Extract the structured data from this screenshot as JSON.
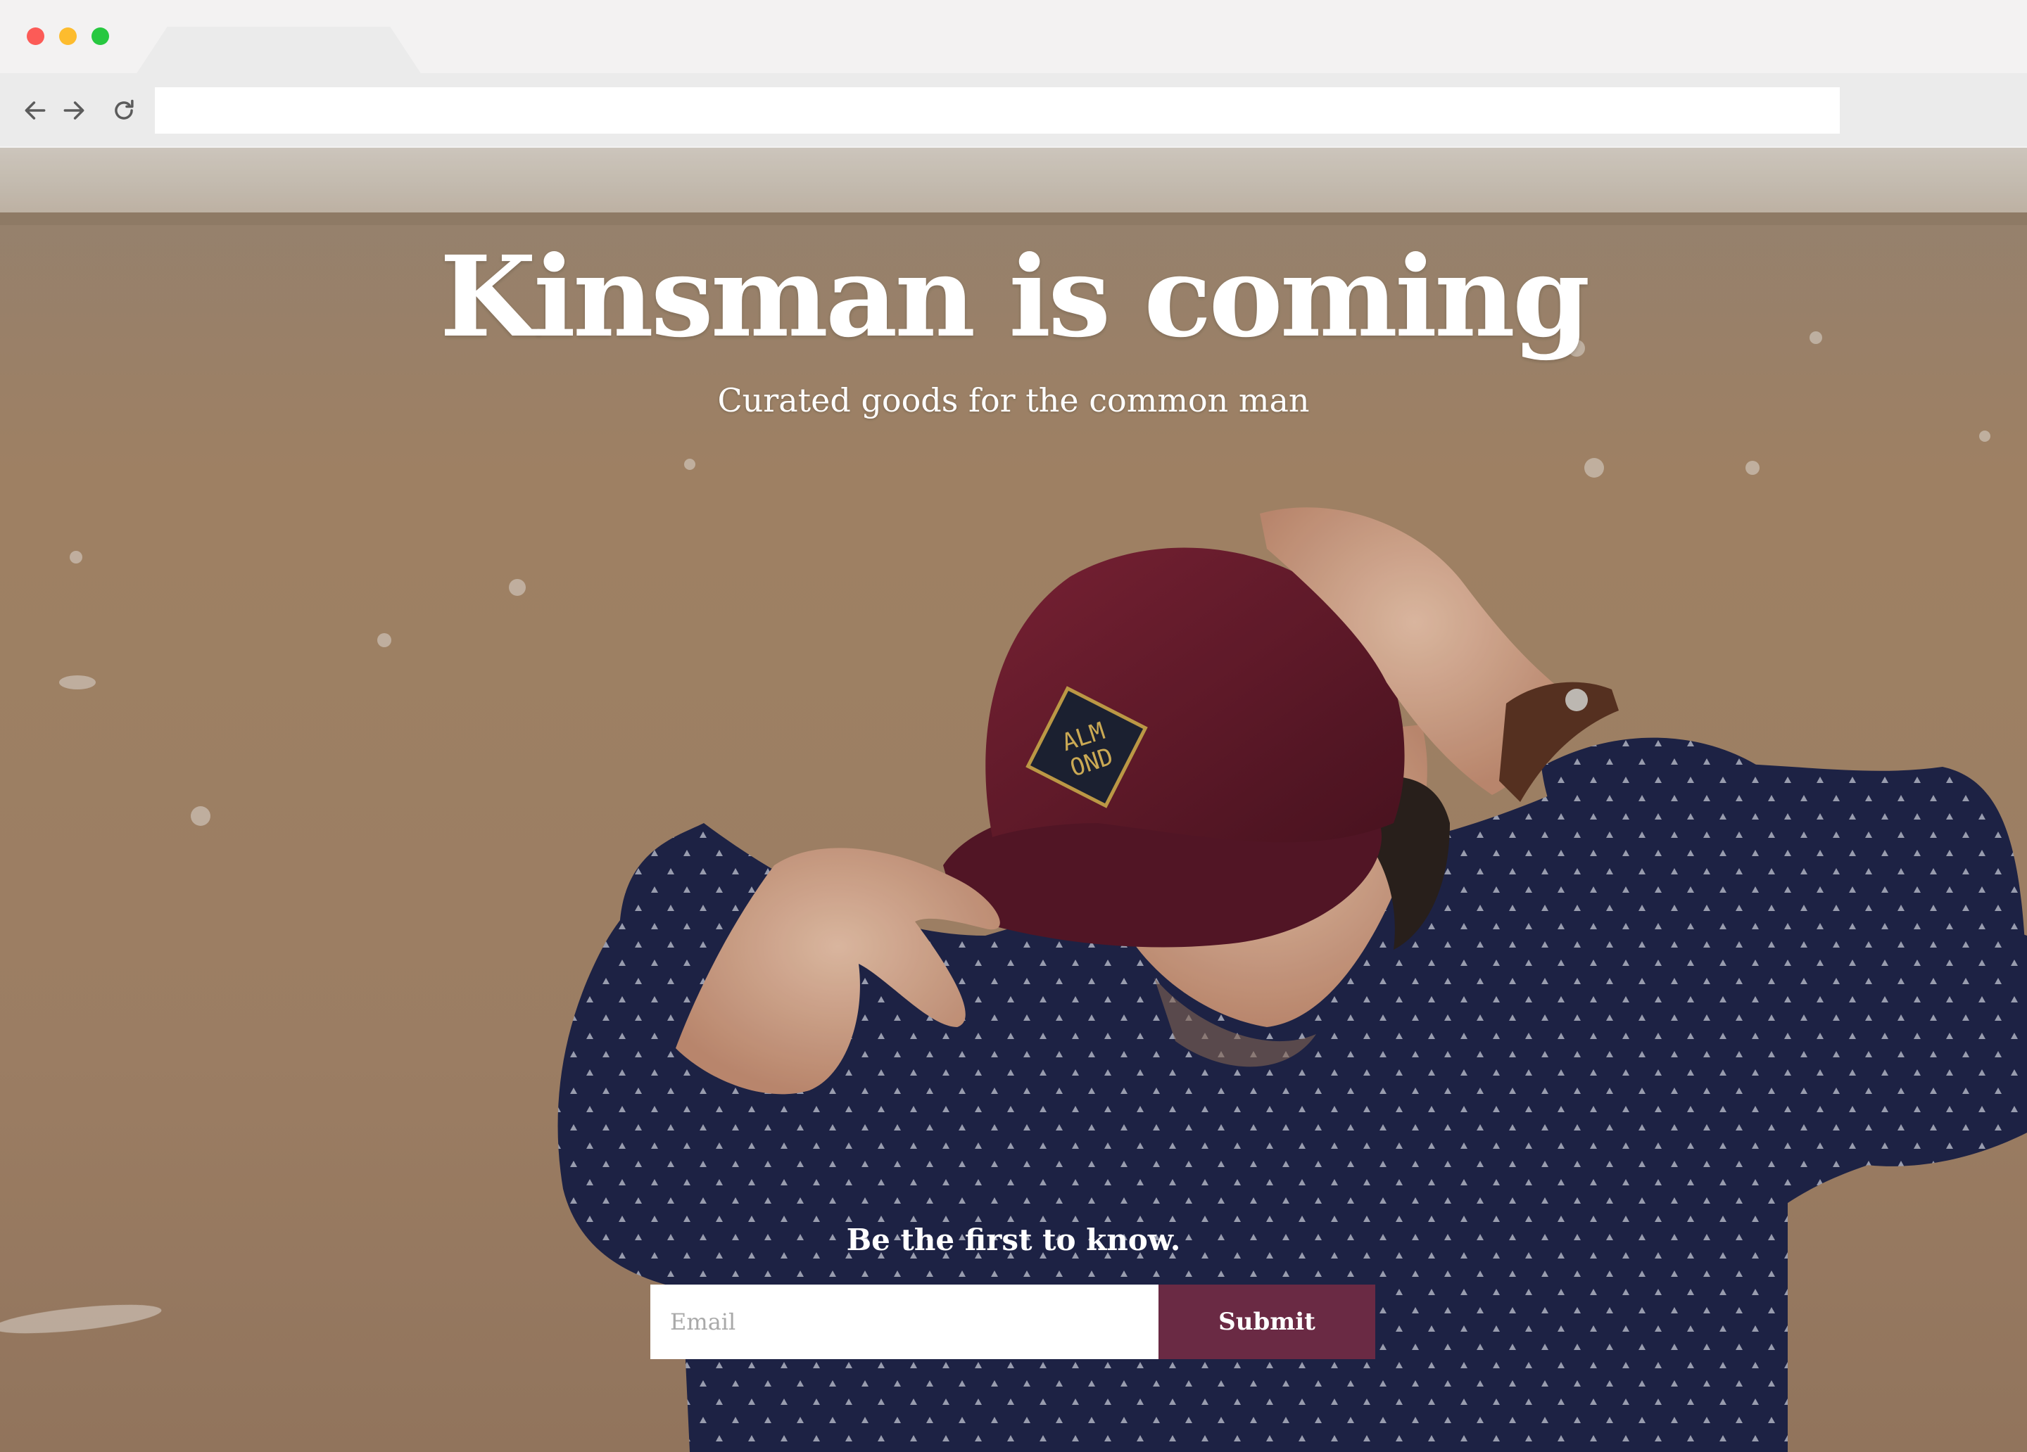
{
  "browser": {
    "address_value": "",
    "traffic_lights": {
      "close": "#fc5b57",
      "minimize": "#fdbc2e",
      "zoom": "#27c840"
    },
    "icons": {
      "back": "arrow-left-icon",
      "forward": "arrow-right-icon",
      "reload": "reload-icon"
    }
  },
  "hero": {
    "headline": "Kinsman is coming",
    "subheadline": "Curated goods for the common man"
  },
  "signup": {
    "prompt": "Be the first to know.",
    "email_placeholder": "Email",
    "submit_label": "Submit",
    "accent_color": "#6a2a44"
  },
  "cap_logo_lines": [
    "ALM",
    "OND"
  ]
}
